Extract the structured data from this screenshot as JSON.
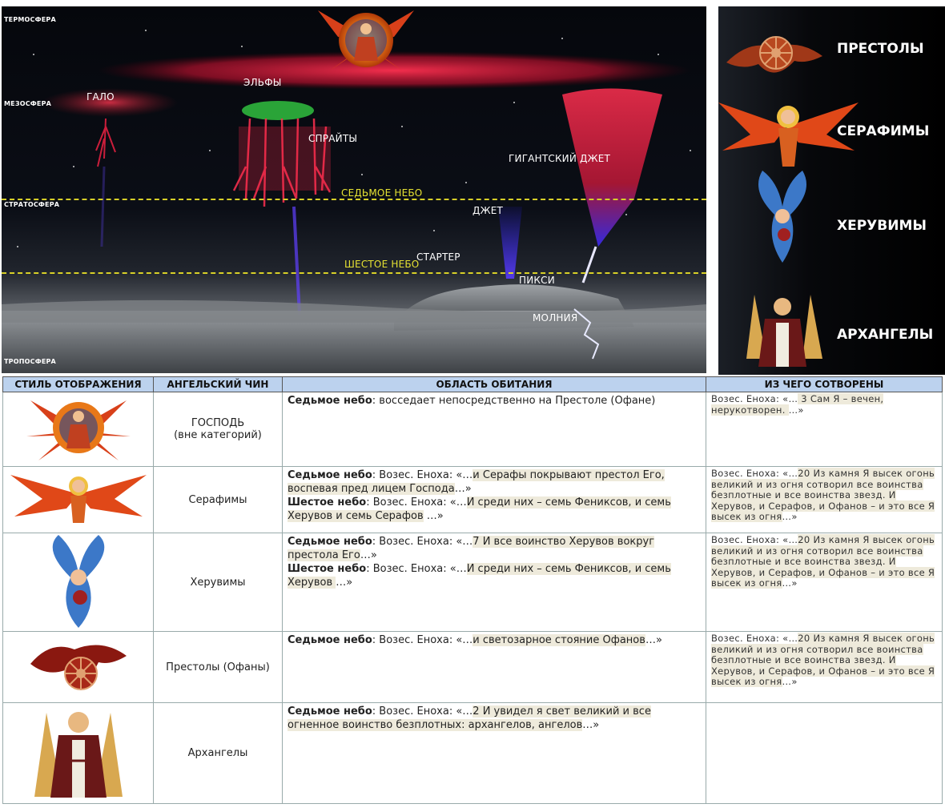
{
  "sky": {
    "layers": {
      "thermosphere": "ТЕРМОСФЕРА",
      "mesosphere": "МЕЗОСФЕРА",
      "stratosphere": "СТРАТОСФЕРА",
      "troposphere": "ТРОПОСФЕРА"
    },
    "phenomena": {
      "halo": "ГАЛО",
      "elves": "ЭЛЬФЫ",
      "sprites": "СПРАЙТЫ",
      "gigantic_jet": "ГИГАНТСКИЙ ДЖЕТ",
      "jet": "ДЖЕТ",
      "starter": "СТАРТЕР",
      "pixie": "ПИКСИ",
      "lightning": "МОЛНИЯ"
    },
    "heavens": {
      "seventh": "СЕДЬМОЕ НЕБО",
      "sixth": "ШЕСТОЕ НЕБО"
    }
  },
  "ranks_panel": [
    "ПРЕСТОЛЫ",
    "СЕРАФИМЫ",
    "ХЕРУВИМЫ",
    "АРХАНГЕЛЫ"
  ],
  "table": {
    "headers": [
      "СТИЛЬ ОТОБРАЖЕНИЯ",
      "АНГЕЛЬСКИЙ ЧИН",
      "ОБЛАСТЬ ОБИТАНИЯ",
      "ИЗ ЧЕГО СОТВОРЕНЫ"
    ],
    "rows": [
      {
        "icon": "christ-icon",
        "name": "ГОСПОДЬ",
        "name_sub": "(вне категорий)",
        "area": [
          {
            "label": "Седьмое небо",
            "text": ": восседает непосредственно на Престоле (Офане)",
            "quote": ""
          }
        ],
        "source_prefix": "Возес. Еноха: «…",
        "source_quote": " 3 Сам Я – вечен, нерукотворен. ",
        "source_suffix": " …»"
      },
      {
        "icon": "seraph-icon",
        "name": "Серафимы",
        "name_sub": "",
        "area": [
          {
            "label": "Седьмое небо",
            "text": ": Возес. Еноха: «…",
            "quote": "и Серафы покрывают престол Его, воспевая пред лицем Господа",
            "end": "…»"
          },
          {
            "label": "Шестое небо",
            "text": ": Возес. Еноха: «…",
            "quote": "И среди них – семь Фениксов, и семь Херувов и семь Серафов",
            "end": " …»"
          }
        ],
        "source_prefix": "Возес. Еноха: «…",
        "source_quote": "20 Из камня Я высек огонь великий и из огня сотворил все воинства безплотные и все воинства звезд. И Херувов, и Серафов, и Офанов – и это все Я высек из огня",
        "source_suffix": "…»"
      },
      {
        "icon": "cherub-icon",
        "name": "Херувимы",
        "name_sub": "",
        "area": [
          {
            "label": "Седьмое небо",
            "text": ": Возес. Еноха: «…",
            "quote": "7 И все воинство Херувов вокруг престола Его",
            "end": "…»"
          },
          {
            "label": "Шестое небо",
            "text": ": Возес. Еноха: «…",
            "quote": "И среди них – семь Фениксов, и семь Херувов ",
            "end": "…»"
          }
        ],
        "source_prefix": "Возес. Еноха: «…",
        "source_quote": "20 Из камня Я высек огонь великий и из огня сотворил все воинства безплотные и все воинства звезд. И Херувов, и Серафов, и Офанов – и это все Я высек из огня",
        "source_suffix": "…»"
      },
      {
        "icon": "throne-wheel-icon",
        "name": "Престолы (Офаны)",
        "name_sub": "",
        "area": [
          {
            "label": "Седьмое небо",
            "text": ": Возес. Еноха: «…",
            "quote": "и светозарное стояние Офанов",
            "end": "…»"
          }
        ],
        "source_prefix": "Возес. Еноха: «…",
        "source_quote": "20 Из камня Я высек огонь великий и из огня сотворил все воинства безплотные и все воинства звезд. И Херувов, и Серафов, и Офанов – и это все Я высек из огня",
        "source_suffix": "…»"
      },
      {
        "icon": "archangel-icon",
        "name": "Архангелы",
        "name_sub": "",
        "area": [
          {
            "label": "Седьмое небо",
            "text": ": Возес. Еноха: «…",
            "quote": "2 И увидел я свет великий и все огненное воинство безплотных: архангелов, ангелов",
            "end": "…»"
          }
        ],
        "source_prefix": "",
        "source_quote": "",
        "source_suffix": ""
      }
    ]
  },
  "colors": {
    "header_bg": "#bcd2ee",
    "highlight": "#eeeadb",
    "dashed_line": "#d8d028",
    "sprite_red": "#e02040"
  }
}
